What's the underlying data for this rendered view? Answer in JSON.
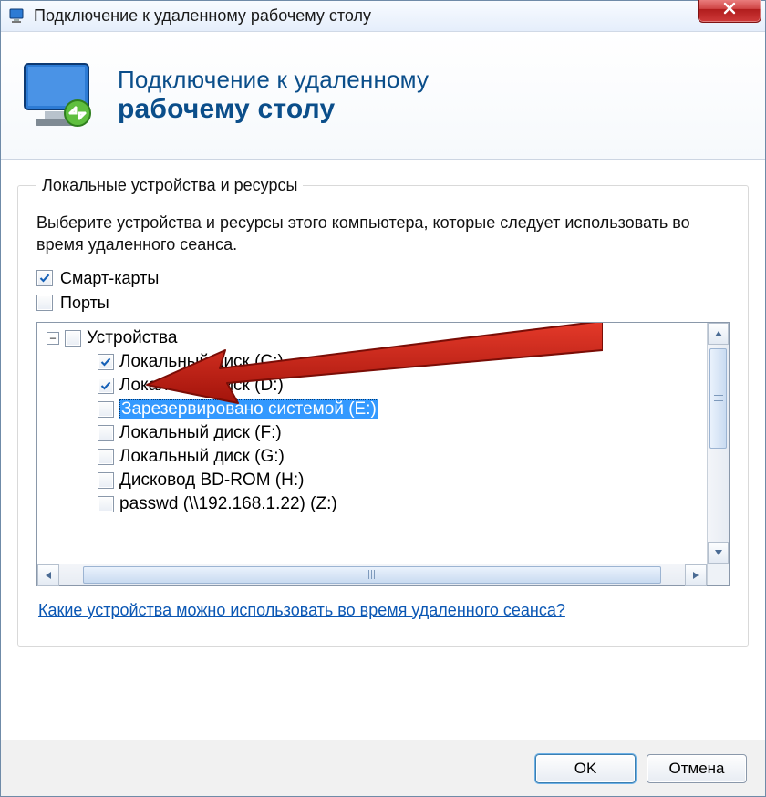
{
  "window": {
    "title": "Подключение к удаленному рабочему столу"
  },
  "banner": {
    "line1": "Подключение к удаленному",
    "line2": "рабочему столу"
  },
  "group": {
    "legend": "Локальные устройства и ресурсы",
    "instruction": "Выберите устройства и ресурсы этого компьютера, которые следует использовать во время удаленного сеанса."
  },
  "top_checks": [
    {
      "label": "Смарт-карты",
      "checked": true
    },
    {
      "label": "Порты",
      "checked": false
    }
  ],
  "tree": {
    "root": {
      "label": "Устройства",
      "checked": false,
      "expanded": true
    },
    "children": [
      {
        "label": "Локальный диск (C:)",
        "checked": true,
        "selected": false
      },
      {
        "label": "Локальный диск (D:)",
        "checked": true,
        "selected": false
      },
      {
        "label": "Зарезервировано системой (E:)",
        "checked": false,
        "selected": true
      },
      {
        "label": "Локальный диск (F:)",
        "checked": false,
        "selected": false
      },
      {
        "label": "Локальный диск (G:)",
        "checked": false,
        "selected": false
      },
      {
        "label": "Дисковод BD-ROM (H:)",
        "checked": false,
        "selected": false
      },
      {
        "label": "passwd (\\\\192.168.1.22) (Z:)",
        "checked": false,
        "selected": false
      }
    ]
  },
  "help_link": "Какие устройства можно использовать во время удаленного сеанса?",
  "buttons": {
    "ok": "OK",
    "cancel": "Отмена"
  }
}
